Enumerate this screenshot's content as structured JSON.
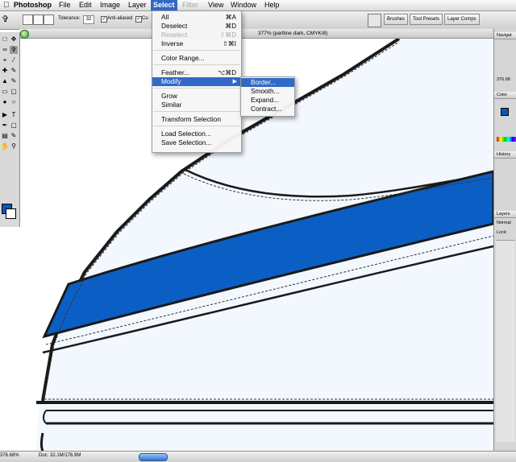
{
  "menubar": {
    "apple": "",
    "items": [
      {
        "label": "Photoshop",
        "bold": true
      },
      {
        "label": "File"
      },
      {
        "label": "Edit"
      },
      {
        "label": "Image"
      },
      {
        "label": "Layer"
      },
      {
        "label": "Select",
        "active": true
      },
      {
        "label": "Filter",
        "disabled": true
      },
      {
        "label": "View"
      },
      {
        "label": "Window"
      },
      {
        "label": "Help"
      }
    ]
  },
  "options_bar": {
    "tolerance_label": "Tolerance:",
    "tolerance_value": "32",
    "anti_aliased_label": "Anti-aliased",
    "contiguous_label": "Co",
    "palette_tabs": [
      "Brushes",
      "Tool Presets",
      "Layer Comps"
    ]
  },
  "document": {
    "title": "377% (partline dark, CMYK/8)",
    "zoom": "376.68%",
    "doc_size": "Doc: 32.1M/176.9M"
  },
  "select_menu": {
    "items": [
      {
        "label": "All",
        "shortcut": "⌘A"
      },
      {
        "label": "Deselect",
        "shortcut": "⌘D"
      },
      {
        "label": "Reselect",
        "shortcut": "⇧⌘D",
        "disabled": true
      },
      {
        "label": "Inverse",
        "shortcut": "⇧⌘I"
      },
      {
        "label": "Color Range..."
      },
      {
        "label": "Feather...",
        "shortcut": "⌥⌘D"
      },
      {
        "label": "Modify",
        "highlighted": true,
        "submenu": true
      },
      {
        "label": "Grow"
      },
      {
        "label": "Similar"
      },
      {
        "label": "Transform Selection"
      },
      {
        "label": "Load Selection..."
      },
      {
        "label": "Save Selection..."
      }
    ]
  },
  "modify_submenu": {
    "items": [
      {
        "label": "Border...",
        "highlighted": true
      },
      {
        "label": "Smooth..."
      },
      {
        "label": "Expand..."
      },
      {
        "label": "Contract..."
      }
    ]
  },
  "right_panels": {
    "navigator": "Navigat",
    "navigator_zoom": "376.68",
    "color": "Color",
    "history": "History",
    "layers": "Layers",
    "layers_mode": "Normal",
    "lock": "Lock:"
  },
  "colors": {
    "accent": "#3169c6",
    "stripe_blue": "#0b5fc4",
    "shoe_fill": "#f2f8fd",
    "foreground": "#0b58b8"
  }
}
